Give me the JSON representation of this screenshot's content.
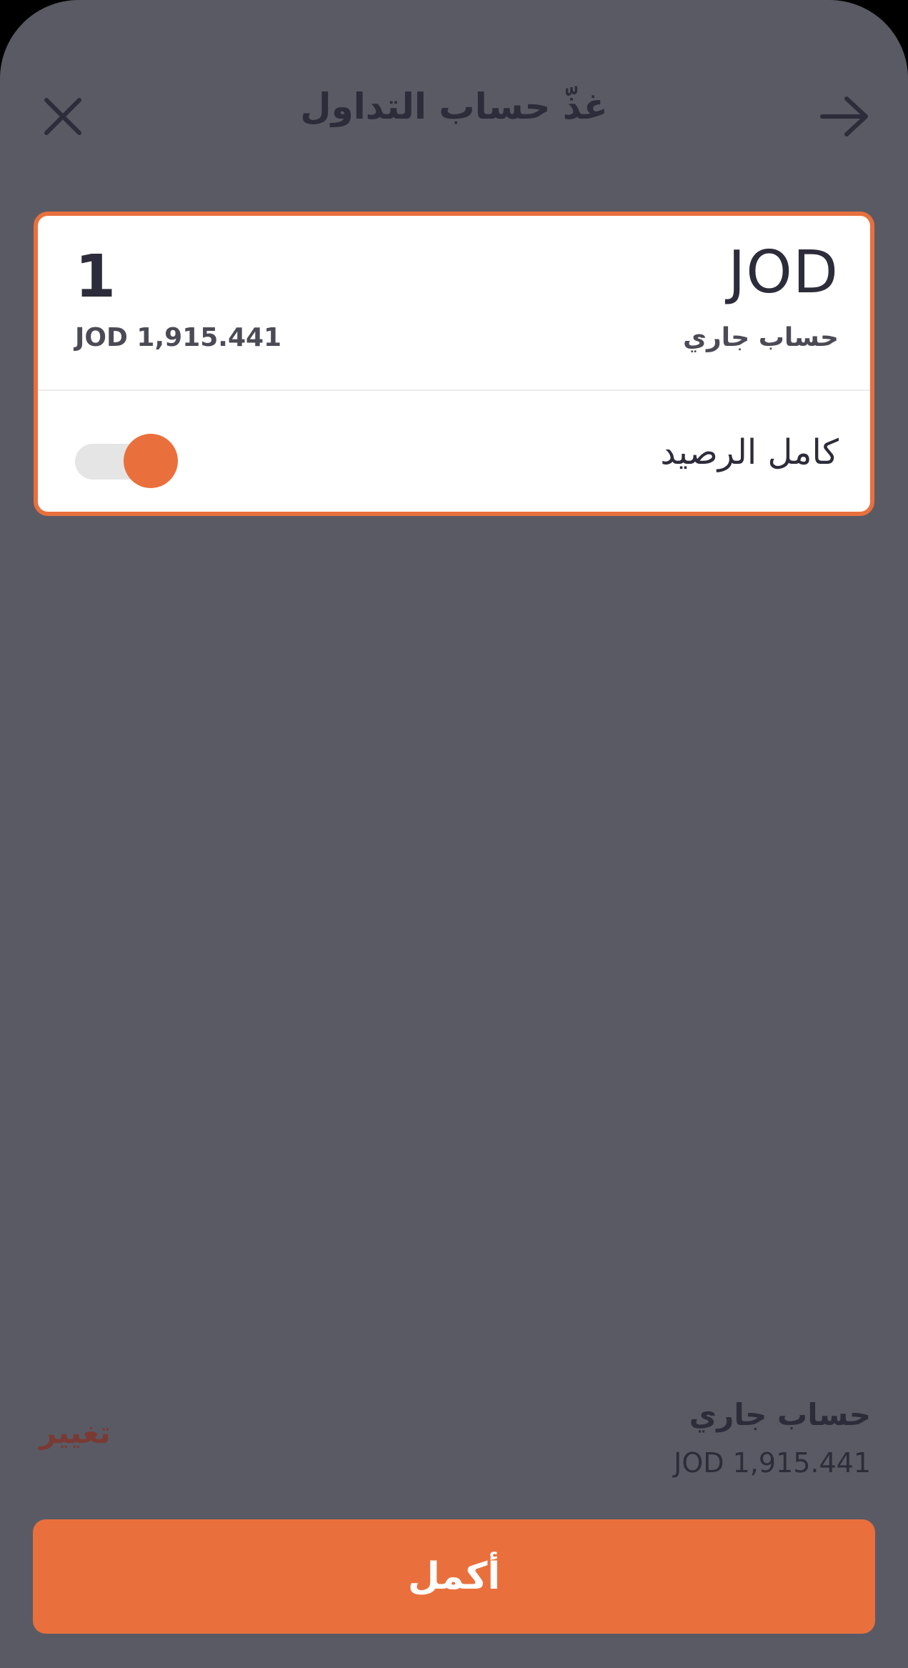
{
  "header": {
    "title": "غذّ حساب التداول",
    "close_icon": "close-icon",
    "back_icon": "arrow-right-icon"
  },
  "card": {
    "currency_code": "JOD",
    "account_type": "حساب جاري",
    "amount": "1",
    "balance": "JOD 1,915.441",
    "full_balance_label": "كامل الرصيد",
    "full_balance_toggle_on": true
  },
  "summary": {
    "account_type": "حساب جاري",
    "balance": "JOD 1,915.441",
    "change_label": "تغيير"
  },
  "footer": {
    "continue_label": "أكمل"
  },
  "colors": {
    "accent": "#e9703d",
    "overlay": "#5a5a64",
    "text_dark": "#2c2c3a",
    "link": "#7a3a34"
  }
}
